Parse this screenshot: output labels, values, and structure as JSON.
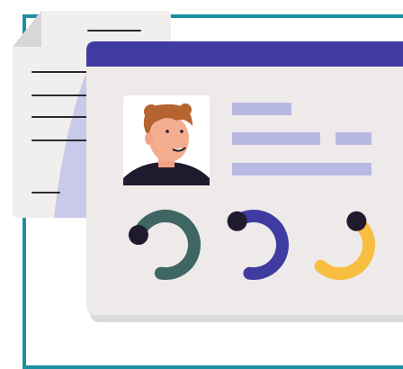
{
  "illustration": {
    "colors": {
      "frame_border": "#1b8fa0",
      "card_header": "#3f3ba0",
      "card_body": "#efeaea",
      "placeholder_bar": "#b7b9e3",
      "document_lines": "#2b2b2b",
      "document_shadow": "#c9c9ea",
      "ring_dark_green": "#3e6663",
      "ring_indigo": "#3f3ba0",
      "ring_yellow": "#f7be41",
      "ring_knob": "#1f1a2e"
    },
    "progress_rings": [
      {
        "label": "",
        "value_fraction": 0.72,
        "color_key": "ring_dark_green"
      },
      {
        "label": "",
        "value_fraction": 0.62,
        "color_key": "ring_indigo"
      },
      {
        "label": "",
        "value_fraction": 0.52,
        "color_key": "ring_yellow"
      }
    ],
    "icons": [
      "document-icon",
      "profile-avatar-icon"
    ]
  }
}
